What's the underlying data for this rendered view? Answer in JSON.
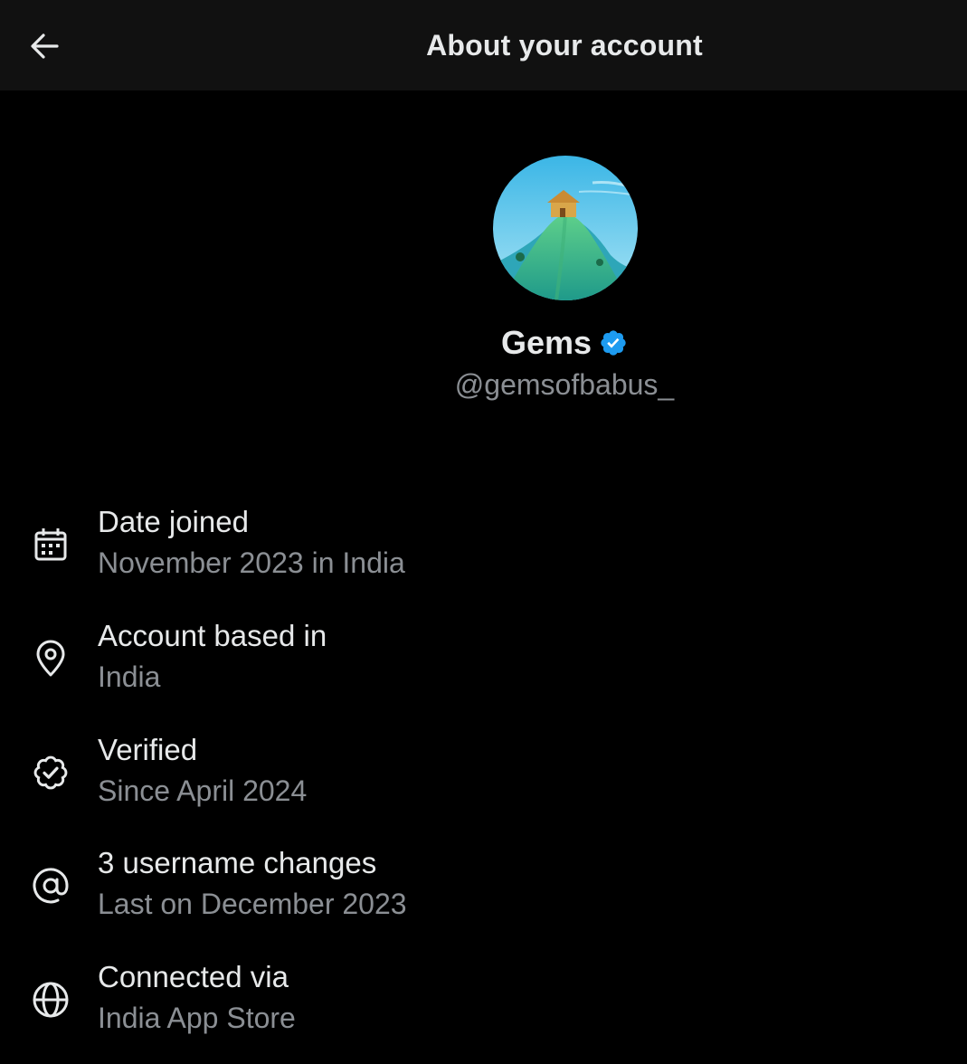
{
  "header": {
    "title": "About your account",
    "back_icon": "arrow-left-icon"
  },
  "profile": {
    "display_name": "Gems",
    "handle": "@gemsofbabus_",
    "verified": true,
    "badge_color": "#1d9bf0"
  },
  "info": [
    {
      "icon": "calendar-icon",
      "title": "Date joined",
      "subtitle": "November 2023 in India"
    },
    {
      "icon": "location-pin-icon",
      "title": "Account based in",
      "subtitle": "India"
    },
    {
      "icon": "verified-check-icon",
      "title": "Verified",
      "subtitle": "Since April 2024"
    },
    {
      "icon": "at-sign-icon",
      "title": "3 username changes",
      "subtitle": "Last on December 2023"
    },
    {
      "icon": "globe-icon",
      "title": "Connected via",
      "subtitle": "India App Store"
    }
  ],
  "colors": {
    "background": "#000000",
    "header_background": "#111111",
    "primary_text": "#e7e9ea",
    "secondary_text": "#8b8f94"
  }
}
